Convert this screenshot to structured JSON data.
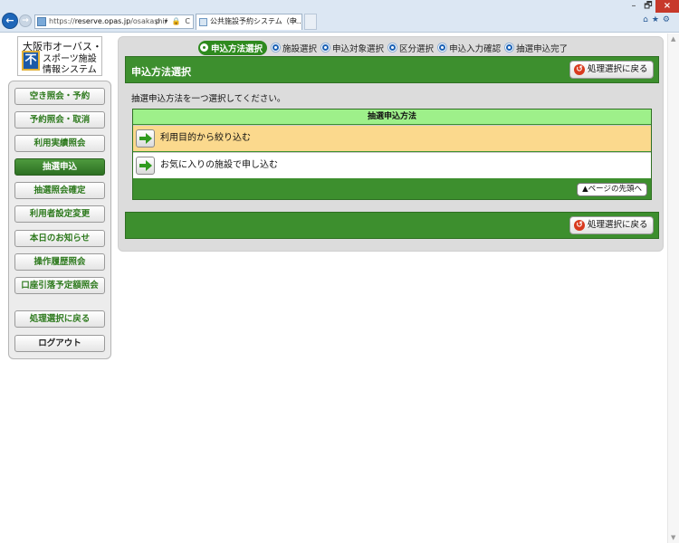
{
  "browser": {
    "url_prefix": "https://",
    "url_domain": "reserve.opas.jp",
    "url_path": "/osakashi/",
    "url_tools": "ρ ▾ 🔒 C",
    "tab_title": "公共施設予約システム（申...",
    "tab_close": "×",
    "window_min": "–",
    "window_max": "🗗",
    "window_close": "×",
    "right_icons": "⌂★⚙"
  },
  "logo": {
    "line1": "大阪市オーバス・",
    "line2": "スポーツ施設",
    "line3": "情報システム",
    "mark": "不"
  },
  "sidebar": {
    "items": [
      {
        "label": "空き照会・予約"
      },
      {
        "label": "予約照会・取消"
      },
      {
        "label": "利用実績照会"
      },
      {
        "label": "抽選申込"
      },
      {
        "label": "抽選照会確定"
      },
      {
        "label": "利用者設定変更"
      },
      {
        "label": "本日のお知らせ"
      },
      {
        "label": "操作履歴照会"
      },
      {
        "label": "口座引落予定額照会"
      },
      {
        "label": "処理選択に戻る"
      },
      {
        "label": "ログアウト"
      }
    ]
  },
  "steps": [
    {
      "label": "申込方法選択",
      "current": true
    },
    {
      "label": "施設選択"
    },
    {
      "label": "申込対象選択"
    },
    {
      "label": "区分選択"
    },
    {
      "label": "申込入力確認"
    },
    {
      "label": "抽選申込完了"
    }
  ],
  "main": {
    "title": "申込方法選択",
    "back_label": "処理選択に戻る",
    "instruction": "抽選申込方法を一つ選択してください。",
    "table_header": "抽選申込方法",
    "options": [
      {
        "label": "利用目的から絞り込む"
      },
      {
        "label": "お気に入りの施設で申し込む"
      }
    ],
    "page_top_label": "▲ページの先頭へ",
    "footer_back_label": "処理選択に戻る"
  }
}
